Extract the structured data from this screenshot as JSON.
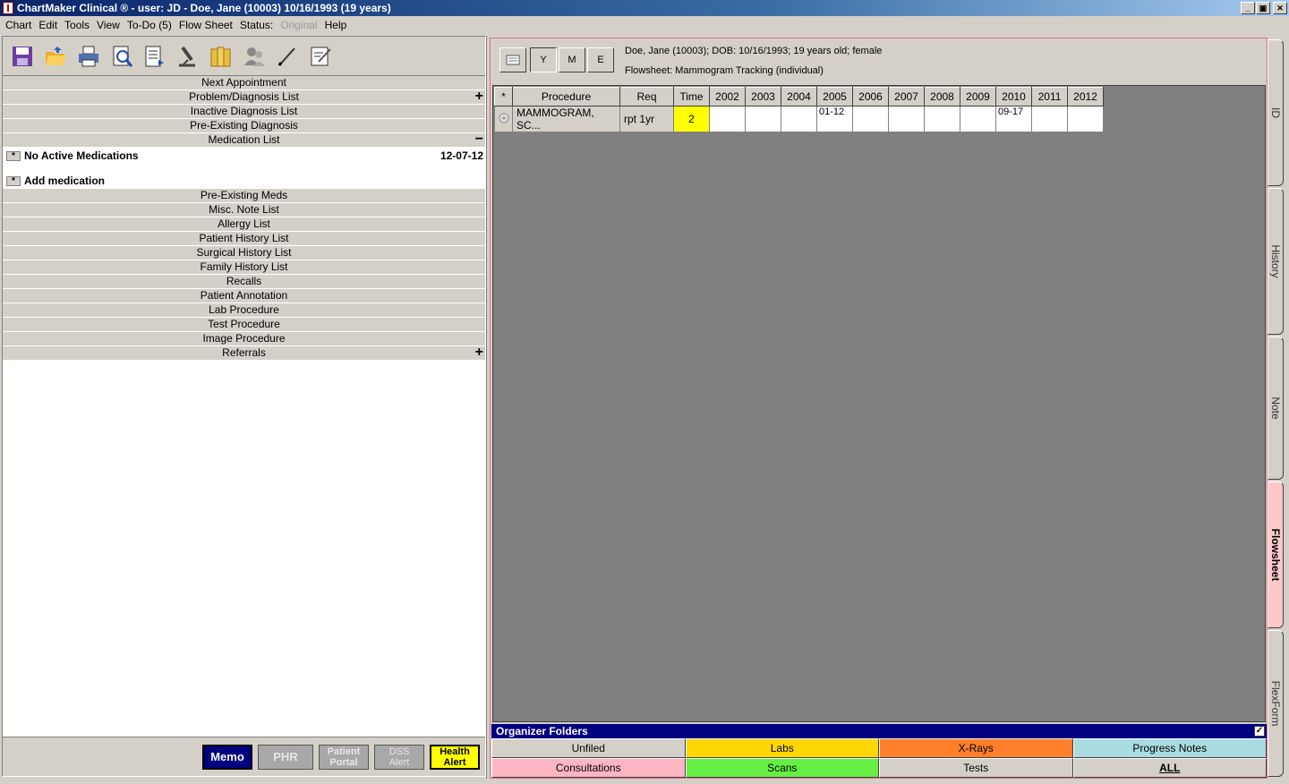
{
  "window": {
    "title": "ChartMaker Clinical ® - user: JD - Doe, Jane (10003) 10/16/1993 (19 years)"
  },
  "menu": {
    "chart": "Chart",
    "edit": "Edit",
    "tools": "Tools",
    "view": "View",
    "todo": "To-Do (5)",
    "flowsheet": "Flow Sheet",
    "status": "Status:",
    "original": "Original",
    "help": "Help"
  },
  "toolbar_icons": [
    "save-icon",
    "open-folder-icon",
    "print-icon",
    "preview-icon",
    "document-list-icon",
    "microscope-icon",
    "folders-icon",
    "users-icon",
    "pen-icon",
    "note-edit-icon"
  ],
  "sections": {
    "next_appointment": "Next Appointment",
    "problem_list": "Problem/Diagnosis List",
    "inactive_diagnosis": "Inactive Diagnosis List",
    "pre_existing_diagnosis": "Pre-Existing Diagnosis",
    "medication_list": "Medication List",
    "no_active_meds": "No Active Medications",
    "no_active_meds_date": "12-07-12",
    "add_medication": "Add medication",
    "star": "*",
    "plus": "+",
    "minus": "−",
    "lower": [
      "Pre-Existing Meds",
      "Misc. Note List",
      "Allergy List",
      "Patient History List",
      "Surgical History List",
      "Family History List",
      "Recalls",
      "Patient Annotation",
      "Lab Procedure",
      "Test Procedure",
      "Image Procedure"
    ],
    "referrals": "Referrals"
  },
  "bottom_buttons": {
    "memo": "Memo",
    "phr": "PHR",
    "patient_portal_1": "Patient",
    "patient_portal_2": "Portal",
    "dss_1": "DSS",
    "dss_2": "Alert",
    "health_1": "Health",
    "health_2": "Alert"
  },
  "flowsheet": {
    "ymd": [
      "Y",
      "M",
      "E"
    ],
    "patient_info": "Doe, Jane (10003); DOB: 10/16/1993; 19 years old; female",
    "flowsheet_label": "Flowsheet:  Mammogram Tracking (individual)",
    "headers": {
      "star": "*",
      "procedure": "Procedure",
      "req": "Req",
      "time": "Time",
      "years": [
        "2002",
        "2003",
        "2004",
        "2005",
        "2006",
        "2007",
        "2008",
        "2009",
        "2010",
        "2011",
        "2012"
      ]
    },
    "row": {
      "procedure": "MAMMOGRAM, SC...",
      "req": "rpt 1yr",
      "time": "2",
      "values": [
        "",
        "",
        "",
        "01-12",
        "",
        "",
        "",
        "",
        "09-17",
        "",
        ""
      ]
    }
  },
  "organizer": {
    "title": "Organizer Folders",
    "check": "✓",
    "unfiled": "Unfiled",
    "labs": "Labs",
    "xrays": "X-Rays",
    "progress": "Progress Notes",
    "consultations": "Consultations",
    "scans": "Scans",
    "tests": "Tests",
    "all": "ALL"
  },
  "tabs": {
    "id": "ID",
    "history": "History",
    "note": "Note",
    "flowsheet": "Flowsheet",
    "flexform": "FlexForm"
  }
}
